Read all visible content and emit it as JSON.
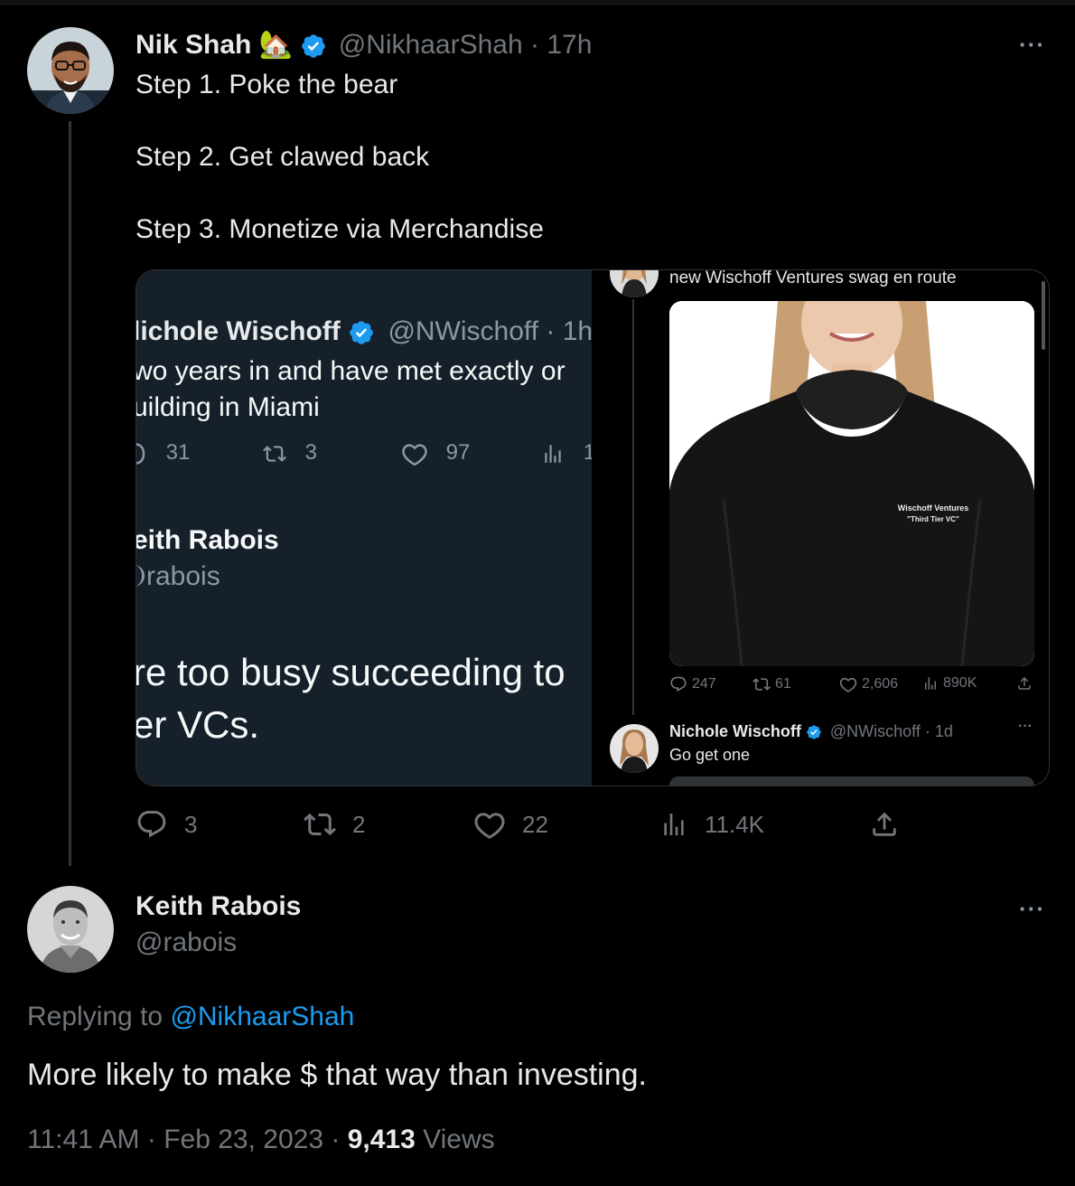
{
  "parent_tweet": {
    "author_name": "Nik Shah",
    "author_emoji": "🏡",
    "author_handle": "@NikhaarShah",
    "time_sep": "·",
    "time": "17h",
    "text_lines": [
      "Step 1. Poke the bear",
      "Step 2. Get clawed back",
      "Step 3. Monetize via Merchandise"
    ],
    "more_label": "···",
    "actions": {
      "replies": "3",
      "retweets": "2",
      "likes": "22",
      "views": "11.4K"
    }
  },
  "media": {
    "left": {
      "tweet_name": "lichole Wischoff",
      "tweet_handle": "@NWischoff · 1h",
      "tweet_line1": "wo years in and have met exactly or",
      "tweet_line2": "uilding in Miami",
      "stats": {
        "replies": "31",
        "retweets": "3",
        "likes": "97",
        "views": "1"
      },
      "reply_name": "eith Rabois",
      "reply_handle": "rabois",
      "quote_line1": "re too busy succeeding to",
      "quote_line2": "er VCs."
    },
    "right": {
      "caption": "new Wischoff Ventures swag en route",
      "shirt_line1": "Wischoff Ventures",
      "shirt_line2": "\"Third Tier VC\"",
      "stats": {
        "replies": "247",
        "retweets": "61",
        "likes": "2,606",
        "views": "890K"
      },
      "reply_name": "Nichole Wischoff",
      "reply_handle": "@NWischoff · 1d",
      "reply_text": "Go get one",
      "more_label": "···"
    }
  },
  "main_tweet": {
    "author_name": "Keith Rabois",
    "author_handle": "@rabois",
    "replying_prefix": "Replying to ",
    "replying_handle": "@NikhaarShah",
    "text": "More likely to make $ that way than investing.",
    "time": "11:41 AM",
    "date": "Feb 23, 2023",
    "sep": "·",
    "views_count": "9,413",
    "views_label": "Views",
    "more_label": "···"
  },
  "colors": {
    "background": "#000000",
    "text": "#e7e9ea",
    "muted": "#71767b",
    "link": "#1d9bf0",
    "verified": "#1d9bf0",
    "card_left_bg": "#15202b"
  }
}
